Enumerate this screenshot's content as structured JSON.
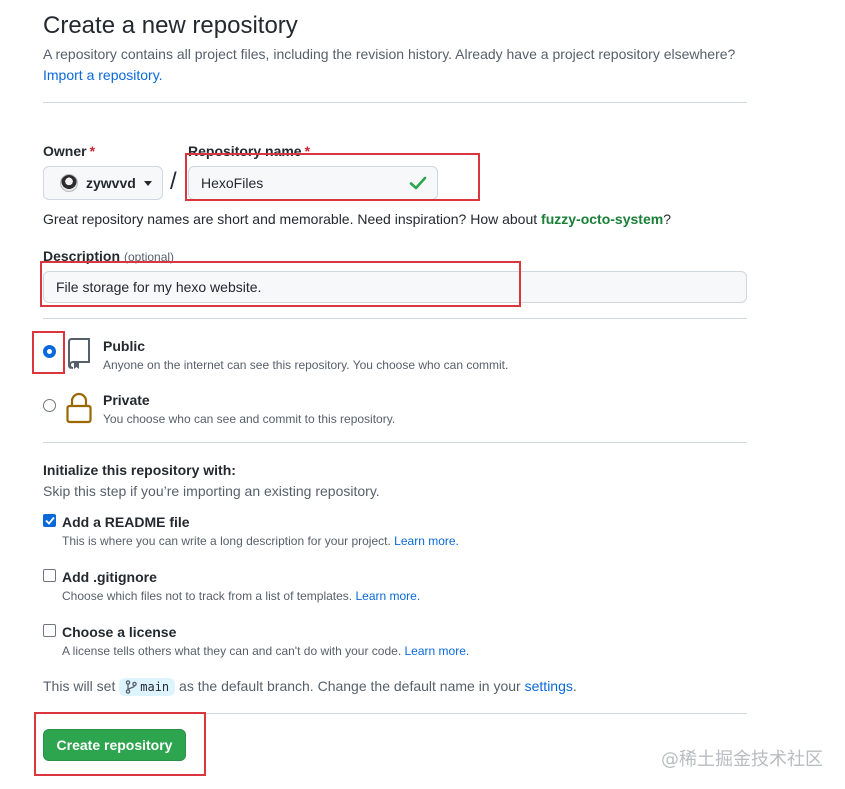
{
  "header": {
    "title": "Create a new repository",
    "subtitle": "A repository contains all project files, including the revision history. Already have a project repository elsewhere?",
    "import_link": "Import a repository."
  },
  "owner": {
    "label": "Owner",
    "required": "*",
    "value": "zywvvd",
    "icon": "avatar"
  },
  "repo_name": {
    "label": "Repository name",
    "required": "*",
    "value": "HexoFiles",
    "valid_icon": "check-icon",
    "separator": "/"
  },
  "hint": {
    "text": "Great repository names are short and memorable. Need inspiration? How about",
    "suggestion": "fuzzy-octo-system",
    "end": "?"
  },
  "description": {
    "label": "Description",
    "optional": "(optional)",
    "value": "File storage for my hexo website."
  },
  "visibility": {
    "selected": "public",
    "options": [
      {
        "key": "public",
        "title": "Public",
        "desc": "Anyone on the internet can see this repository. You choose who can commit.",
        "icon": "repo-book-icon"
      },
      {
        "key": "private",
        "title": "Private",
        "desc": "You choose who can see and commit to this repository.",
        "icon": "lock-icon"
      }
    ]
  },
  "init": {
    "heading": "Initialize this repository with:",
    "subheading": "Skip this step if you’re importing an existing repository.",
    "learn_more": "Learn more.",
    "options": [
      {
        "title": "Add a README file",
        "desc": "This is where you can write a long description for your project.",
        "checked": true
      },
      {
        "title": "Add .gitignore",
        "desc": "Choose which files not to track from a list of templates.",
        "checked": false
      },
      {
        "title": "Choose a license",
        "desc": "A license tells others what they can and can't do with your code.",
        "checked": false
      }
    ]
  },
  "branch": {
    "prefix": "This will set",
    "name": "main",
    "middle": "as the default branch. Change the default name in your",
    "settings_link": "settings",
    "end": "."
  },
  "create_button": "Create repository",
  "watermark": "@稀土掘金技术社区",
  "colors": {
    "primary_button": "#2da44e",
    "link": "#0969da",
    "suggestion": "#1a7f37",
    "highlight_box": "#d9363e"
  }
}
